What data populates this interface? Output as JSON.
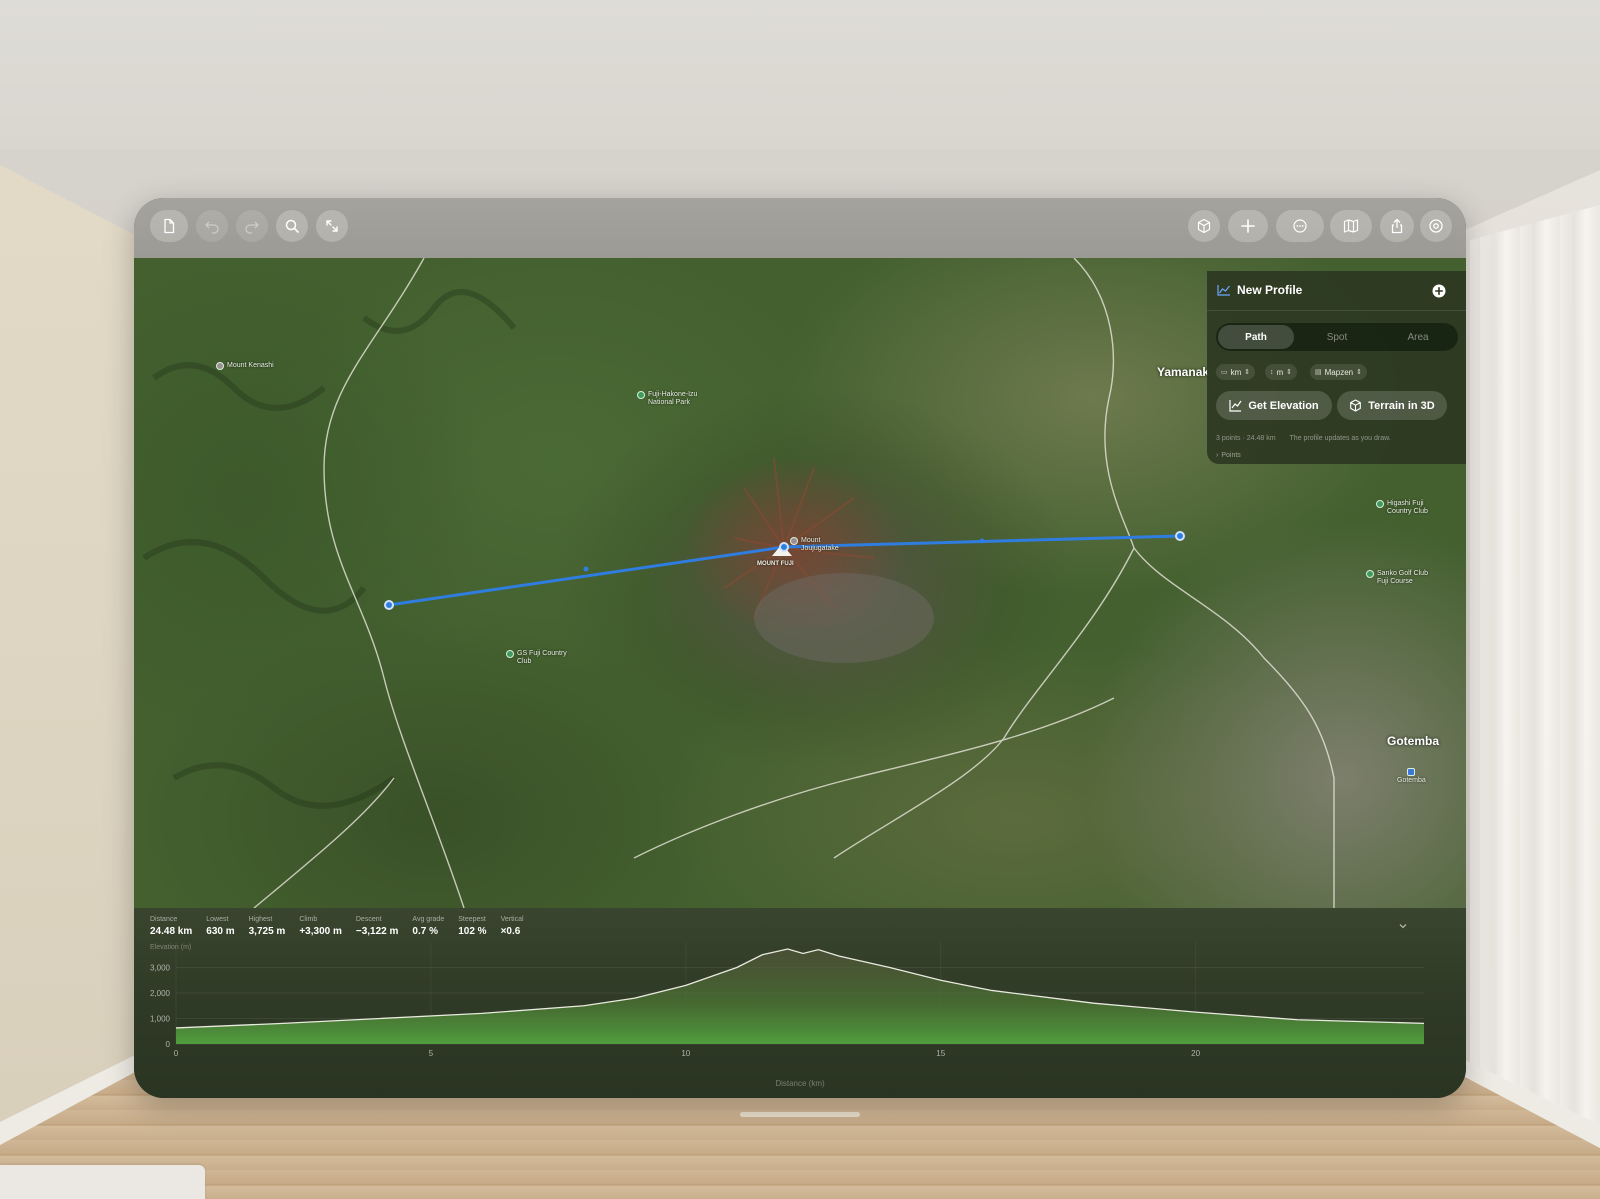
{
  "toolbar": {
    "left": [
      {
        "name": "new-document-button",
        "icon": "document-icon"
      },
      {
        "name": "undo-button",
        "icon": "undo-icon",
        "disabled": true
      },
      {
        "name": "redo-button",
        "icon": "redo-icon",
        "disabled": true
      },
      {
        "name": "search-button",
        "icon": "search-icon"
      },
      {
        "name": "expand-button",
        "icon": "expand-icon"
      }
    ],
    "right": [
      {
        "name": "terrain-3d-toolbar-button",
        "icon": "cube-icon"
      },
      {
        "name": "add-button",
        "icon": "plus-icon"
      },
      {
        "name": "more-button",
        "icon": "ellipsis-icon"
      },
      {
        "name": "map-style-button",
        "icon": "map-icon"
      },
      {
        "name": "share-button",
        "icon": "share-icon"
      },
      {
        "name": "settings-button",
        "icon": "gear-icon"
      }
    ]
  },
  "map": {
    "labels": {
      "mount_kenashi": "Mount Kenashi",
      "fuji_hakone_izu": "Fuji-Hakone-Izu National Park",
      "mount_jouju": "Mount Joujugatake",
      "mount_fuji": "MOUNT FUJI",
      "gs_fuji": "GS Fuji Country Club",
      "higashi_fuji": "Higashi Fuji Country Club",
      "sanko_golf": "Sanko Golf Club Fuji Course",
      "yamanaka": "Yamanak",
      "gotemba": "Gotemba",
      "gotemba_station": "Gotemba"
    },
    "route_color": "#2f7de0",
    "satellite_colors": {
      "forest": "#44602f",
      "summit": "#7a4a36",
      "urban": "#7d7f6c"
    }
  },
  "panel": {
    "title": "New Profile",
    "title_icon": "chart-line-icon",
    "add_icon": "plus-circle-icon",
    "segments": [
      "Path",
      "Spot",
      "Area"
    ],
    "active_segment": "Path",
    "chips": {
      "distance_unit": "km",
      "height_unit": "m",
      "source": "Mapzen"
    },
    "get_elevation": "Get Elevation",
    "terrain_3d": "Terrain in 3D",
    "summary": "3 points · 24.48 km",
    "hint": "The profile updates as you draw.",
    "points_label": "Points"
  },
  "stats": [
    {
      "label": "Distance",
      "value": "24.48 km"
    },
    {
      "label": "Lowest",
      "value": "630 m"
    },
    {
      "label": "Highest",
      "value": "3,725 m"
    },
    {
      "label": "Climb",
      "value": "+3,300 m"
    },
    {
      "label": "Descent",
      "value": "−3,122 m"
    },
    {
      "label": "Avg grade",
      "value": "0.7 %"
    },
    {
      "label": "Steepest",
      "value": "102 %"
    },
    {
      "label": "Vertical",
      "value": "×0.6"
    }
  ],
  "chart_data": {
    "type": "area",
    "ylabel": "Elevation (m)",
    "xlabel": "Distance (km)",
    "xlim": [
      0,
      24.48
    ],
    "ylim": [
      0,
      4000
    ],
    "xticks": [
      0,
      5,
      10,
      15,
      20
    ],
    "xtick_labels": [
      "0",
      "5",
      "10",
      "15",
      "20"
    ],
    "yticks": [
      0,
      1000,
      2000,
      3000
    ],
    "ytick_labels": [
      "0",
      "1,000",
      "2,000",
      "3,000"
    ],
    "grid": true,
    "series": [
      {
        "color": "#4f9e3e",
        "x": [
          0,
          2,
          4,
          6,
          8,
          9,
          10,
          11,
          11.5,
          12,
          12.3,
          12.6,
          13,
          14,
          15,
          16,
          18,
          20,
          22,
          24.48
        ],
        "y": [
          630,
          800,
          1000,
          1200,
          1500,
          1800,
          2300,
          3000,
          3500,
          3725,
          3550,
          3700,
          3450,
          3000,
          2500,
          2100,
          1600,
          1250,
          950,
          810
        ]
      }
    ]
  }
}
